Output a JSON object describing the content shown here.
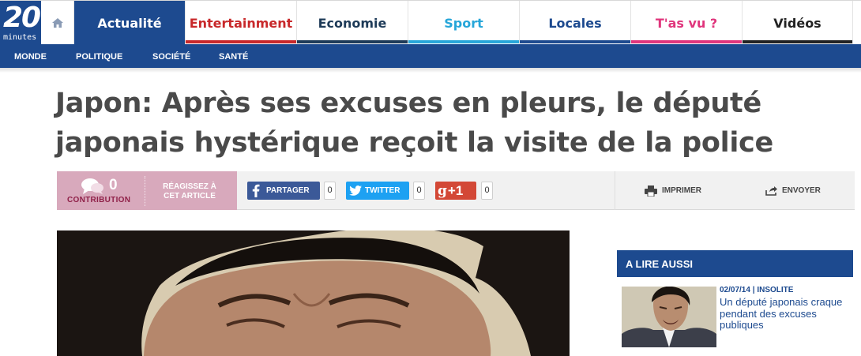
{
  "logo": {
    "number": "20",
    "word": "minutes"
  },
  "nav": {
    "home_icon": "home-icon",
    "tabs": [
      {
        "label": "Actualité",
        "color": "#1d4a8f",
        "active": true
      },
      {
        "label": "Entertainment",
        "color": "#c8282a",
        "active": false
      },
      {
        "label": "Economie",
        "color": "#1e3b58",
        "active": false
      },
      {
        "label": "Sport",
        "color": "#27a6d9",
        "active": false
      },
      {
        "label": "Locales",
        "color": "#1d4a8f",
        "active": false
      },
      {
        "label": "T'as vu ?",
        "color": "#e0357c",
        "active": false
      },
      {
        "label": "Vidéos",
        "color": "#222222",
        "active": false
      }
    ]
  },
  "subnav": {
    "items": [
      "MONDE",
      "POLITIQUE",
      "SOCIÉTÉ",
      "SANTÉ"
    ]
  },
  "article": {
    "title_line1": "Japon: Après ses excuses en pleurs, le député",
    "title_line2": "japonais hystérique reçoit la visite de la police"
  },
  "sharebar": {
    "contribution_count": "0",
    "contribution_label": "CONTRIBUTION",
    "react_line1": "RÉAGISSEZ À",
    "react_line2": "CET ARTICLE",
    "facebook_label": "PARTAGER",
    "facebook_count": "0",
    "twitter_label": "TWITTER",
    "twitter_count": "0",
    "gplus_label": "+1",
    "gplus_count": "0",
    "print_label": "IMPRIMER",
    "send_label": "ENVOYER"
  },
  "aside": {
    "heading": "A LIRE AUSSI",
    "related": {
      "date": "02/07/14",
      "category": "INSOLITE",
      "title": "Un député japonais craque pendant des excuses publiques"
    }
  },
  "colors": {
    "brand_blue": "#1d4a8f",
    "contribution_pink": "#d8a9bc",
    "facebook": "#3b5998",
    "twitter": "#1da1f2",
    "gplus": "#d34836"
  }
}
